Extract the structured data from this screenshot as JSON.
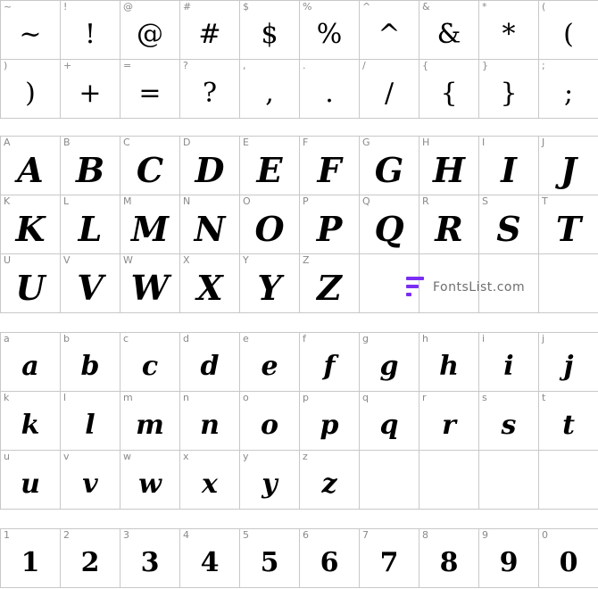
{
  "symbols": [
    {
      "label": "~",
      "glyph": "~"
    },
    {
      "label": "!",
      "glyph": "!"
    },
    {
      "label": "@",
      "glyph": "@"
    },
    {
      "label": "#",
      "glyph": "#"
    },
    {
      "label": "$",
      "glyph": "$"
    },
    {
      "label": "%",
      "glyph": "%"
    },
    {
      "label": "^",
      "glyph": "^"
    },
    {
      "label": "&",
      "glyph": "&"
    },
    {
      "label": "*",
      "glyph": "*"
    },
    {
      "label": "(",
      "glyph": "("
    },
    {
      "label": ")",
      "glyph": ")"
    },
    {
      "label": "+",
      "glyph": "+"
    },
    {
      "label": "=",
      "glyph": "="
    },
    {
      "label": "?",
      "glyph": "?"
    },
    {
      "label": ",",
      "glyph": ","
    },
    {
      "label": ".",
      "glyph": "."
    },
    {
      "label": "/",
      "glyph": "/"
    },
    {
      "label": "{",
      "glyph": "{"
    },
    {
      "label": "}",
      "glyph": "}"
    },
    {
      "label": ";",
      "glyph": ";"
    }
  ],
  "uppercase": [
    {
      "label": "A",
      "glyph": "A"
    },
    {
      "label": "B",
      "glyph": "B"
    },
    {
      "label": "C",
      "glyph": "C"
    },
    {
      "label": "D",
      "glyph": "D"
    },
    {
      "label": "E",
      "glyph": "E"
    },
    {
      "label": "F",
      "glyph": "F"
    },
    {
      "label": "G",
      "glyph": "G"
    },
    {
      "label": "H",
      "glyph": "H"
    },
    {
      "label": "I",
      "glyph": "I"
    },
    {
      "label": "J",
      "glyph": "J"
    },
    {
      "label": "K",
      "glyph": "K"
    },
    {
      "label": "L",
      "glyph": "L"
    },
    {
      "label": "M",
      "glyph": "M"
    },
    {
      "label": "N",
      "glyph": "N"
    },
    {
      "label": "O",
      "glyph": "O"
    },
    {
      "label": "P",
      "glyph": "P"
    },
    {
      "label": "Q",
      "glyph": "Q"
    },
    {
      "label": "R",
      "glyph": "R"
    },
    {
      "label": "S",
      "glyph": "S"
    },
    {
      "label": "T",
      "glyph": "T"
    },
    {
      "label": "U",
      "glyph": "U"
    },
    {
      "label": "V",
      "glyph": "V"
    },
    {
      "label": "W",
      "glyph": "W"
    },
    {
      "label": "X",
      "glyph": "X"
    },
    {
      "label": "Y",
      "glyph": "Y"
    },
    {
      "label": "Z",
      "glyph": "Z"
    },
    {
      "label": "",
      "glyph": ""
    },
    {
      "label": "",
      "glyph": ""
    },
    {
      "label": "",
      "glyph": ""
    },
    {
      "label": "",
      "glyph": ""
    }
  ],
  "lowercase": [
    {
      "label": "a",
      "glyph": "a"
    },
    {
      "label": "b",
      "glyph": "b"
    },
    {
      "label": "c",
      "glyph": "c"
    },
    {
      "label": "d",
      "glyph": "d"
    },
    {
      "label": "e",
      "glyph": "e"
    },
    {
      "label": "f",
      "glyph": "f"
    },
    {
      "label": "g",
      "glyph": "g"
    },
    {
      "label": "h",
      "glyph": "h"
    },
    {
      "label": "i",
      "glyph": "i"
    },
    {
      "label": "j",
      "glyph": "j"
    },
    {
      "label": "k",
      "glyph": "k"
    },
    {
      "label": "l",
      "glyph": "l"
    },
    {
      "label": "m",
      "glyph": "m"
    },
    {
      "label": "n",
      "glyph": "n"
    },
    {
      "label": "o",
      "glyph": "o"
    },
    {
      "label": "p",
      "glyph": "p"
    },
    {
      "label": "q",
      "glyph": "q"
    },
    {
      "label": "r",
      "glyph": "r"
    },
    {
      "label": "s",
      "glyph": "s"
    },
    {
      "label": "t",
      "glyph": "t"
    },
    {
      "label": "u",
      "glyph": "u"
    },
    {
      "label": "v",
      "glyph": "v"
    },
    {
      "label": "w",
      "glyph": "w"
    },
    {
      "label": "x",
      "glyph": "x"
    },
    {
      "label": "y",
      "glyph": "y"
    },
    {
      "label": "z",
      "glyph": "z"
    },
    {
      "label": "",
      "glyph": ""
    },
    {
      "label": "",
      "glyph": ""
    },
    {
      "label": "",
      "glyph": ""
    },
    {
      "label": "",
      "glyph": ""
    }
  ],
  "digits": [
    {
      "label": "1",
      "glyph": "1"
    },
    {
      "label": "2",
      "glyph": "2"
    },
    {
      "label": "3",
      "glyph": "3"
    },
    {
      "label": "4",
      "glyph": "4"
    },
    {
      "label": "5",
      "glyph": "5"
    },
    {
      "label": "6",
      "glyph": "6"
    },
    {
      "label": "7",
      "glyph": "7"
    },
    {
      "label": "8",
      "glyph": "8"
    },
    {
      "label": "9",
      "glyph": "9"
    },
    {
      "label": "0",
      "glyph": "0"
    }
  ],
  "watermark": {
    "text": "FontsList.com",
    "logo_color": "#7b2cf5"
  }
}
